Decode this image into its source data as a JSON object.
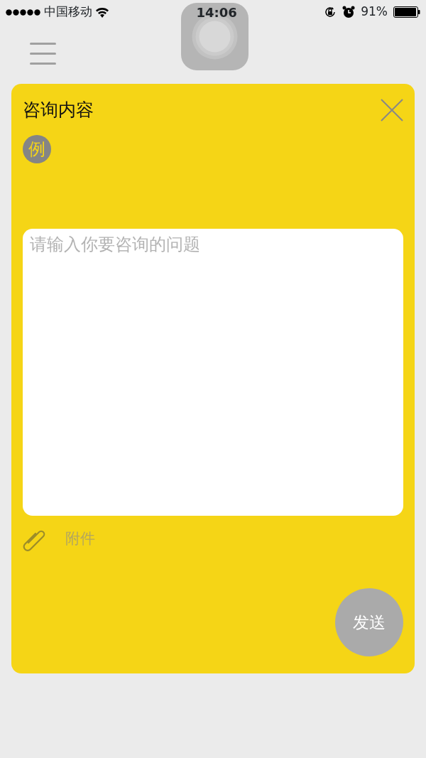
{
  "status_bar": {
    "carrier": "中国移动",
    "time": "14:06",
    "battery_text": "91%"
  },
  "form": {
    "title": "咨询内容",
    "example_badge": "例",
    "question": {
      "placeholder": "请输入你要咨询的问题"
    },
    "attachment_label": "附件",
    "send_button": "发送"
  }
}
